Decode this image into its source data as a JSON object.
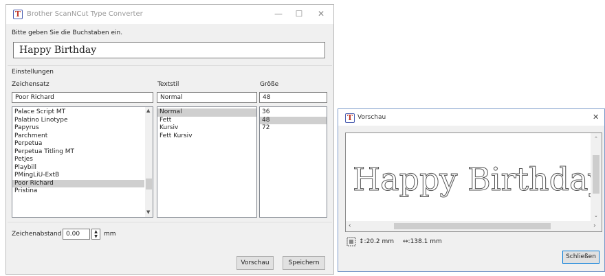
{
  "main": {
    "title": "Brother ScanNCut Type Converter",
    "controls": {
      "minimize": "—",
      "maximize": "☐",
      "close": "✕"
    },
    "prompt": "Bitte geben Sie die Buchstaben ein.",
    "text_value": "Happy Birthday",
    "settings_label": "Einstellungen",
    "font_label": "Zeichensatz",
    "style_label": "Textstil",
    "size_label": "Größe",
    "font_value": "Poor Richard",
    "style_value": "Normal",
    "size_value": "48",
    "fonts": [
      "Palace Script MT",
      "Palatino Linotype",
      "Papyrus",
      "Parchment",
      "Perpetua",
      "Perpetua Titling MT",
      "Petjes",
      "Playbill",
      "PMingLiU-ExtB",
      "Poor Richard",
      "Pristina"
    ],
    "selected_font": "Poor Richard",
    "styles": [
      "Normal",
      "Fett",
      "Kursiv",
      "Fett Kursiv"
    ],
    "selected_style": "Normal",
    "sizes": [
      "36",
      "48",
      "72"
    ],
    "selected_size": "48",
    "spacing_label": "Zeichenabstand",
    "spacing_value": "0.00",
    "spacing_unit": "mm",
    "preview_button": "Vorschau",
    "save_button": "Speichern"
  },
  "preview": {
    "title": "Vorschau",
    "close": "✕",
    "rendered_text": "Happy Birthday",
    "height_readout": "↕:20.2 mm",
    "width_readout": "↔:138.1 mm",
    "close_button": "Schließen",
    "vertical_scroll_fraction": 0.45,
    "horizontal_scroll_fraction": 0.3
  },
  "colors": {
    "selection": "#cfcfcf",
    "preview_border": "#7a99c9",
    "window_bg": "#f0f0f0"
  }
}
